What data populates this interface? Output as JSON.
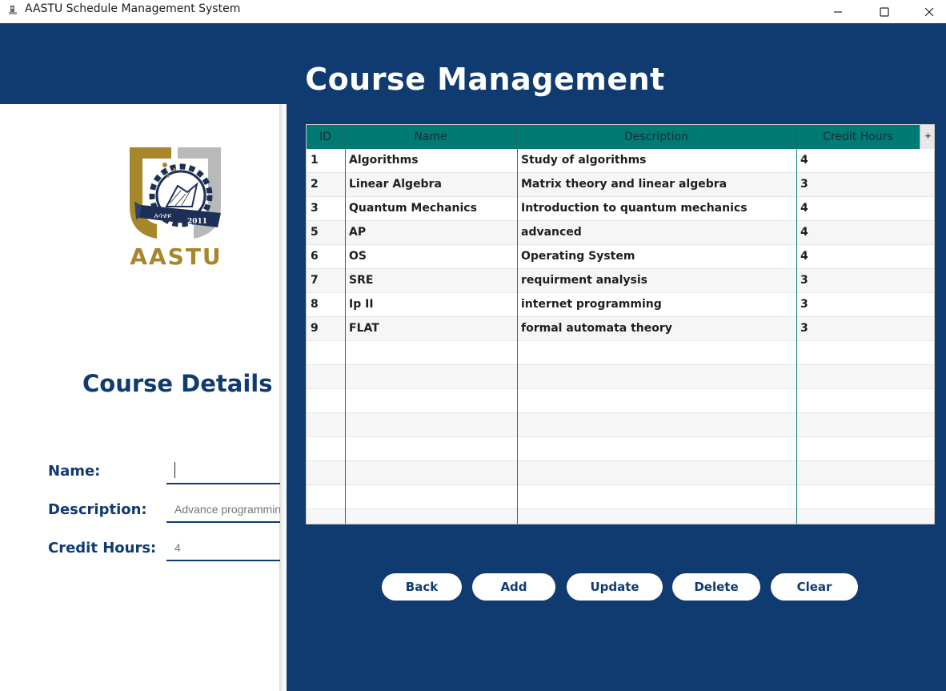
{
  "window": {
    "title": "AASTU Schedule Management System"
  },
  "header": {
    "title": "Course Management"
  },
  "logo": {
    "text": "AASTU",
    "year": "2011",
    "script_text": "አሳቴዩ"
  },
  "form": {
    "section_title": "Course Details",
    "name_label": "Name:",
    "name_value": "",
    "description_label": "Description:",
    "description_placeholder": "Advance programming",
    "credit_hours_label": "Credit Hours:",
    "credit_hours_placeholder": "4"
  },
  "table": {
    "columns": [
      "ID",
      "Name",
      "Description",
      "Credit Hours"
    ],
    "corner_glyph": "+",
    "rows": [
      [
        "1",
        "Algorithms",
        "Study of algorithms",
        "4"
      ],
      [
        "2",
        "Linear Algebra",
        "Matrix theory and linear algebra",
        "3"
      ],
      [
        "3",
        "Quantum Mechanics",
        "Introduction to quantum mechanics",
        "4"
      ],
      [
        "5",
        "AP",
        "advanced",
        "4"
      ],
      [
        "6",
        "OS",
        "Operating System",
        "4"
      ],
      [
        "7",
        "SRE",
        "requirment analysis",
        "3"
      ],
      [
        "8",
        "Ip II",
        "internet programming",
        "3"
      ],
      [
        "9",
        "FLAT",
        "formal automata theory",
        "3"
      ]
    ],
    "empty_rows": 8
  },
  "buttons": {
    "back": "Back",
    "add": "Add",
    "update": "Update",
    "delete": "Delete",
    "clear": "Clear"
  },
  "colors": {
    "primary": "#0f3b70",
    "table_header": "#007a72",
    "logo_gold": "#a8862a"
  },
  "icons": {
    "app": "app-icon",
    "minimize": "minimize-icon",
    "maximize": "maximize-icon",
    "close": "close-icon"
  }
}
